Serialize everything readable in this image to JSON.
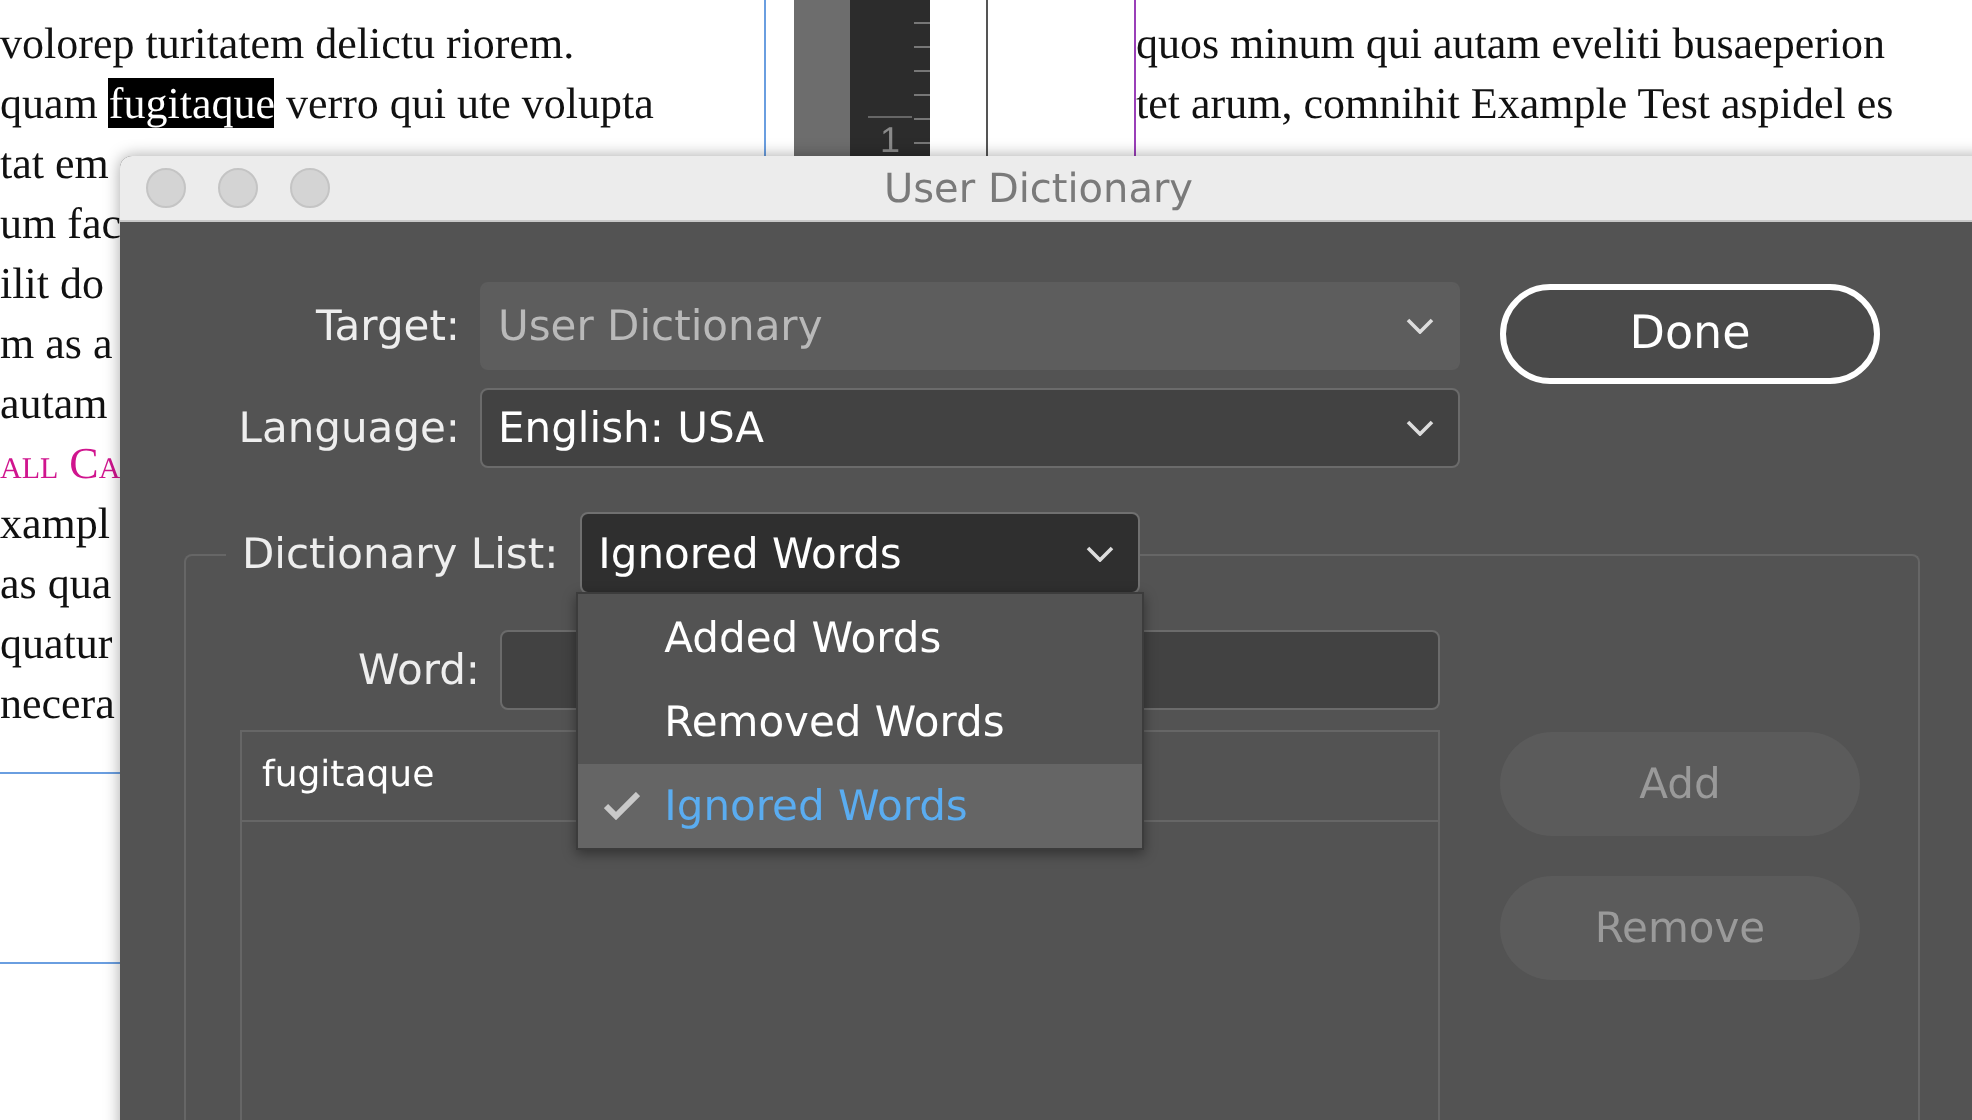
{
  "document": {
    "left_column": [
      {
        "kind": "plain",
        "segments": [
          {
            "text": "volorep turitatem delictu riorem.",
            "highlighted": false
          }
        ]
      },
      {
        "kind": "plain",
        "segments": [
          {
            "text": "quam ",
            "highlighted": false
          },
          {
            "text": "fugitaque",
            "highlighted": true
          },
          {
            "text": " verro qui ute volupta",
            "highlighted": false
          }
        ]
      },
      {
        "kind": "plain",
        "segments": [
          {
            "text": "tat em",
            "highlighted": false
          }
        ]
      },
      {
        "kind": "plain",
        "segments": [
          {
            "text": "um fac",
            "highlighted": false
          }
        ]
      },
      {
        "kind": "plain",
        "segments": [
          {
            "text": "ilit do",
            "highlighted": false
          }
        ]
      },
      {
        "kind": "plain",
        "segments": [
          {
            "text": "m as a",
            "highlighted": false
          }
        ]
      },
      {
        "kind": "plain",
        "segments": [
          {
            "text": "autam",
            "highlighted": false
          }
        ]
      },
      {
        "kind": "small-caps",
        "segments": [
          {
            "text": "all Ca",
            "highlighted": false
          }
        ]
      },
      {
        "kind": "plain",
        "segments": [
          {
            "text": "xampl",
            "highlighted": false
          }
        ]
      },
      {
        "kind": "plain",
        "segments": [
          {
            "text": "as qua",
            "highlighted": false
          }
        ]
      },
      {
        "kind": "plain",
        "segments": [
          {
            "text": "quatur",
            "highlighted": false
          }
        ]
      },
      {
        "kind": "plain",
        "segments": [
          {
            "text": "necera",
            "highlighted": false
          }
        ]
      }
    ],
    "ruler": {
      "label": "1"
    },
    "right_column": [
      {
        "kind": "plain",
        "segments": [
          {
            "text": "quos minum qui autam eveliti busaeperion",
            "highlighted": false
          }
        ]
      },
      {
        "kind": "plain",
        "segments": [
          {
            "text": "tet arum, comnihit Example Test aspidel es",
            "highlighted": false
          }
        ]
      }
    ]
  },
  "dialog": {
    "title": "User Dictionary",
    "target": {
      "label": "Target:",
      "value": "User Dictionary",
      "disabled": true
    },
    "language": {
      "label": "Language:",
      "value": "English: USA",
      "disabled": false
    },
    "done_button": "Done",
    "dictionary_list": {
      "label": "Dictionary List:",
      "value": "Ignored Words",
      "expanded": true,
      "options": [
        {
          "label": "Added Words",
          "selected": false
        },
        {
          "label": "Removed Words",
          "selected": false
        },
        {
          "label": "Ignored Words",
          "selected": true
        }
      ]
    },
    "word": {
      "label": "Word:"
    },
    "words": [
      "fugitaque"
    ],
    "buttons": [
      {
        "label": "Add",
        "disabled": true
      },
      {
        "label": "Remove",
        "disabled": true
      }
    ]
  }
}
